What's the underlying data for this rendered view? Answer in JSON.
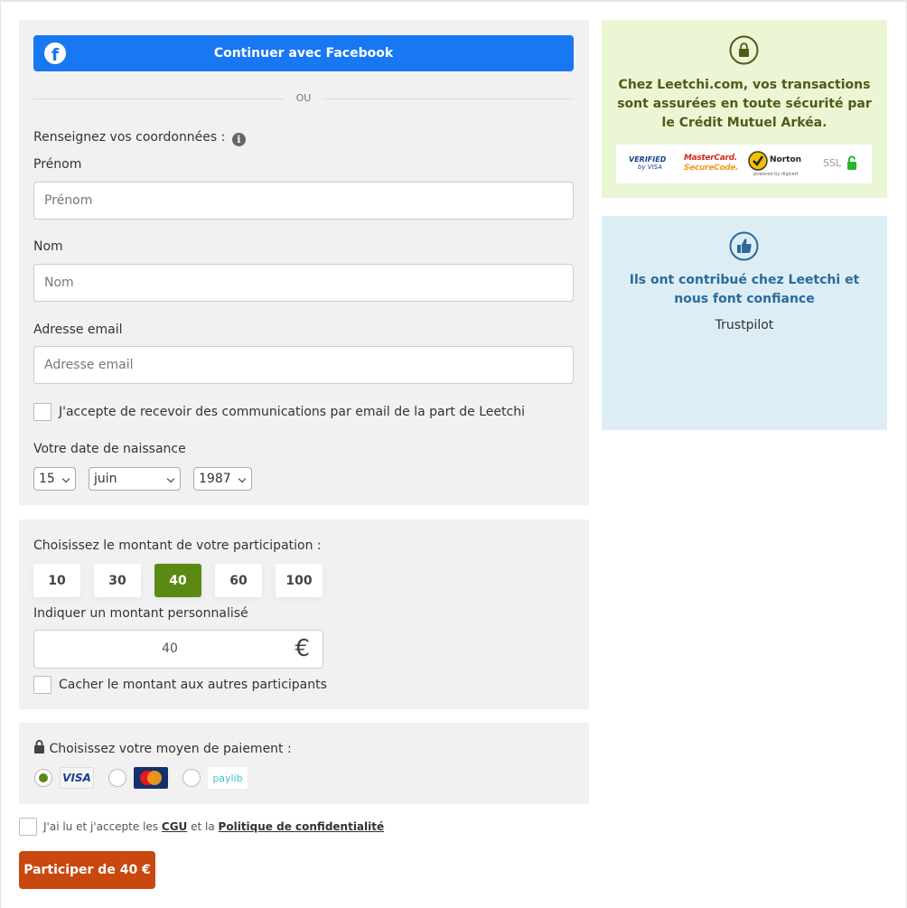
{
  "colors": {
    "facebook": "#1877f2",
    "amount_active": "#5a8a14",
    "cta": "#c9480f",
    "security_panel": "#eaf6d4",
    "security_title": "#4d5c1a",
    "trust_panel": "#dcedf5",
    "trust_title": "#2b6a9a"
  },
  "facebook": {
    "label": "Continuer avec Facebook",
    "icon": "facebook-icon"
  },
  "separator": "OU",
  "contact": {
    "heading": "Renseignez vos coordonnées :",
    "firstname": {
      "label": "Prénom",
      "placeholder": "Prénom"
    },
    "lastname": {
      "label": "Nom",
      "placeholder": "Nom"
    },
    "email": {
      "label": "Adresse email",
      "placeholder": "Adresse email"
    },
    "newsletter": "J'accepte de recevoir des communications par email de la part de Leetchi",
    "birth": {
      "label": "Votre date de naissance",
      "day": "15",
      "month": "juin",
      "year": "1987"
    }
  },
  "amount": {
    "heading": "Choisissez le montant de votre participation :",
    "options": [
      "10",
      "30",
      "40",
      "60",
      "100"
    ],
    "selected": "40",
    "custom_label": "Indiquer un montant personnalisé",
    "custom_value": "40",
    "currency": "€",
    "hide_label": "Cacher le montant aux autres participants"
  },
  "payment": {
    "heading": "Choisissez votre moyen de paiement :",
    "methods": [
      "VISA",
      "MasterCard",
      "paylib"
    ],
    "selected": "VISA"
  },
  "legal": {
    "prefix": "J'ai lu et j'accepte les",
    "cgu": "CGU",
    "middle": "et la",
    "privacy": "Politique de confidentialité"
  },
  "cta": "Participer de 40 €",
  "security": {
    "icon": "lock-icon",
    "text": "Chez Leetchi.com, vos transactions sont assurées en toute sécurité par le Crédit Mutuel Arkéa.",
    "badges": {
      "visa_top": "VERIFIED",
      "visa_bottom": "by VISA",
      "mc_top": "MasterCard.",
      "mc_bottom": "SecureCode.",
      "norton": "Norton",
      "norton_sub": "powered by digicert",
      "ssl": "SSL"
    }
  },
  "trust": {
    "icon": "thumbs-up-icon",
    "title": "Ils ont contribué chez Leetchi et nous font confiance",
    "source": "Trustpilot"
  }
}
